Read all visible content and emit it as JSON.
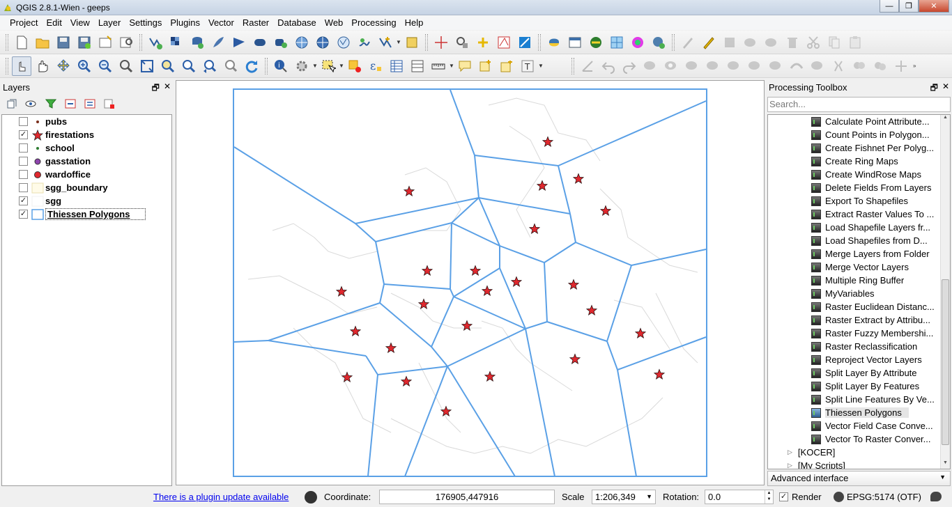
{
  "window": {
    "title": "QGIS 2.8.1-Wien - geeps"
  },
  "menubar": {
    "items": [
      "Project",
      "Edit",
      "View",
      "Layer",
      "Settings",
      "Plugins",
      "Vector",
      "Raster",
      "Database",
      "Web",
      "Processing",
      "Help"
    ]
  },
  "layers_panel": {
    "title": "Layers",
    "layers": [
      {
        "name": "pubs",
        "checked": false,
        "symbol": "point-brown"
      },
      {
        "name": "firestations",
        "checked": true,
        "symbol": "star-red"
      },
      {
        "name": "school",
        "checked": false,
        "symbol": "point-green"
      },
      {
        "name": "gasstation",
        "checked": false,
        "symbol": "point-purple"
      },
      {
        "name": "wardoffice",
        "checked": false,
        "symbol": "point-red"
      },
      {
        "name": "sgg_boundary",
        "checked": false,
        "symbol": "fill-yellow"
      },
      {
        "name": "sgg",
        "checked": true,
        "symbol": "fill-white"
      },
      {
        "name": "Thiessen Polygons",
        "checked": true,
        "symbol": "fill-outline",
        "selected": true
      }
    ]
  },
  "processing_toolbox": {
    "title": "Processing Toolbox",
    "search_placeholder": "Search...",
    "tools": [
      "Calculate Point Attribute...",
      "Count Points in Polygon...",
      "Create Fishnet Per Polyg...",
      "Create Ring Maps",
      "Create WindRose Maps",
      "Delete Fields From Layers",
      "Export To Shapefiles",
      "Extract Raster Values To ...",
      "Load Shapefile Layers fr...",
      "Load Shapefiles from D...",
      "Merge Layers from Folder",
      "Merge Vector Layers",
      "Multiple Ring Buffer",
      "MyVariables",
      "Raster Euclidean Distanc...",
      "Raster Extract by Attribu...",
      "Raster Fuzzy Membershi...",
      "Raster Reclassification",
      "Reproject Vector Layers",
      "Split Layer By Attribute",
      "Split Layer By Features",
      "Split Line Features By Ve...",
      "Thiessen Polygons",
      "Vector Field Case Conve...",
      "Vector To Raster Conver..."
    ],
    "selected_tool": "Thiessen Polygons",
    "groups": [
      "[KOCER]",
      "[My Scripts]"
    ],
    "interface_mode": "Advanced interface"
  },
  "statusbar": {
    "plugin_update": "There is a plugin update available",
    "coordinate_label": "Coordinate:",
    "coordinate": "176905,447916",
    "scale_label": "Scale",
    "scale": "1:206,349",
    "rotation_label": "Rotation:",
    "rotation": "0.0",
    "render_label": "Render",
    "render_checked": true,
    "crs": "EPSG:5174 (OTF)"
  },
  "colors": {
    "voronoi_line": "#5aa0e6",
    "star_fill": "#e0282e",
    "boundary": "#d9d9d9"
  }
}
